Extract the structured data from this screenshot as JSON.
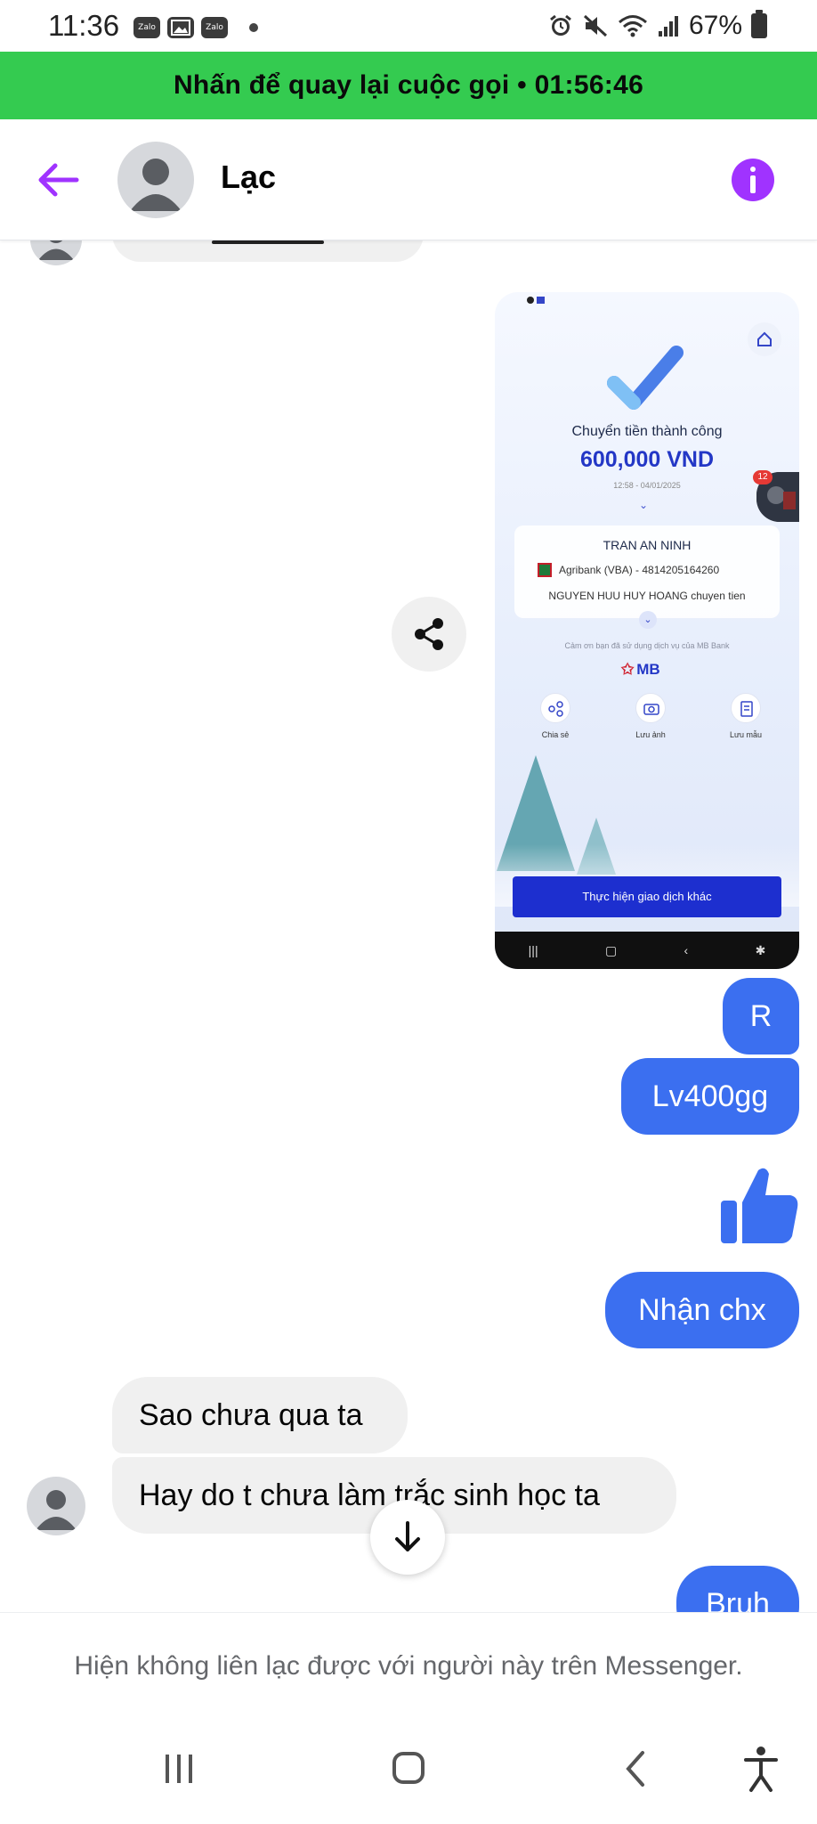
{
  "status_bar": {
    "time": "11:36",
    "notif_icons": [
      "Zalo",
      "image-icon",
      "Zalo"
    ],
    "battery_percent": "67%",
    "right_icons": [
      "alarm-icon",
      "mute-icon",
      "wifi-icon",
      "signal-icon",
      "battery-icon"
    ]
  },
  "call_banner": {
    "text": "Nhấn để quay lại cuộc gọi • 01:56:46",
    "color": "#34cb50"
  },
  "header": {
    "contact_name": "Lạc",
    "accent_color": "#a033ff"
  },
  "receipt": {
    "title": "Chuyển tiền thành công",
    "amount": "600,000 VND",
    "datetime": "12:58 - 04/01/2025",
    "notification_count": "12",
    "recipient": "TRAN AN NINH",
    "bank": "Agribank (VBA) - 4814205164260",
    "description": "NGUYEN HUU HUY HOANG chuyen tien",
    "thanks": "Cảm ơn bạn đã sử dụng dịch vụ của MB Bank",
    "brand": "MB",
    "actions": [
      {
        "label": "Chia sẻ",
        "icon": "share-icon"
      },
      {
        "label": "Lưu ảnh",
        "icon": "camera-icon"
      },
      {
        "label": "Lưu mẫu",
        "icon": "template-icon"
      }
    ],
    "cta": "Thực hiện giao dịch khác",
    "brand_color": "#2337c6"
  },
  "messages": [
    {
      "direction": "out",
      "text": "R"
    },
    {
      "direction": "out",
      "text": "Lv400gg"
    },
    {
      "direction": "out",
      "type": "like",
      "icon": "thumbs-up-icon"
    },
    {
      "direction": "out",
      "text": "Nhận chx"
    },
    {
      "direction": "in",
      "text": "Sao chưa qua ta"
    },
    {
      "direction": "in",
      "text": "Hay do t chưa làm trắc sinh học ta"
    },
    {
      "direction": "out",
      "text": "Bruh"
    }
  ],
  "colors": {
    "outgoing_bubble": "#3b6ff0",
    "incoming_bubble": "#f0f0f0"
  },
  "footer_notice": "Hiện không liên lạc được với người này trên Messenger."
}
